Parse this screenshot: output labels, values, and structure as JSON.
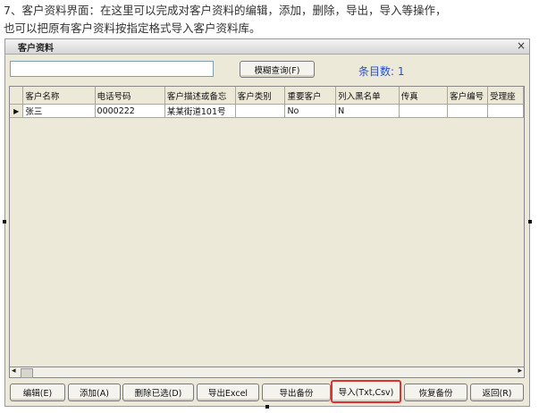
{
  "caption": {
    "line1": "7、客户资料界面：在这里可以完成对客户资料的编辑，添加，删除，导出，导入等操作，",
    "line2": "也可以把原有客户资料按指定格式导入客户资料库。"
  },
  "window": {
    "title": "客户资料",
    "close": "×"
  },
  "search": {
    "value": "",
    "fuzzy_button": "模糊查询(F)"
  },
  "count": {
    "label": "条目数: 1"
  },
  "table": {
    "columns": [
      "客户名称",
      "电话号码",
      "客户描述或备忘",
      "客户类别",
      "重要客户",
      "列入黑名单",
      "传真",
      "客户编号",
      "受理座"
    ],
    "rows": [
      {
        "indicator": "▶",
        "cells": [
          "张三",
          "0000222",
          "某某街道101号",
          "",
          "No",
          "N",
          "",
          "",
          ""
        ]
      }
    ]
  },
  "scrollbar": {
    "left": "◂",
    "right": "▸"
  },
  "buttons": {
    "edit": "编辑(E)",
    "add": "添加(A)",
    "delete_selected": "删除已选(D)",
    "export_excel": "导出Excel",
    "export_backup": "导出备份",
    "import_txt_csv": "导入(Txt,Csv)",
    "restore_backup": "恢复备份",
    "back": "返回(R)"
  },
  "colors": {
    "window_bg": "#ece9d8",
    "count_text": "#2b4fc6",
    "highlight_border": "#e03030"
  }
}
